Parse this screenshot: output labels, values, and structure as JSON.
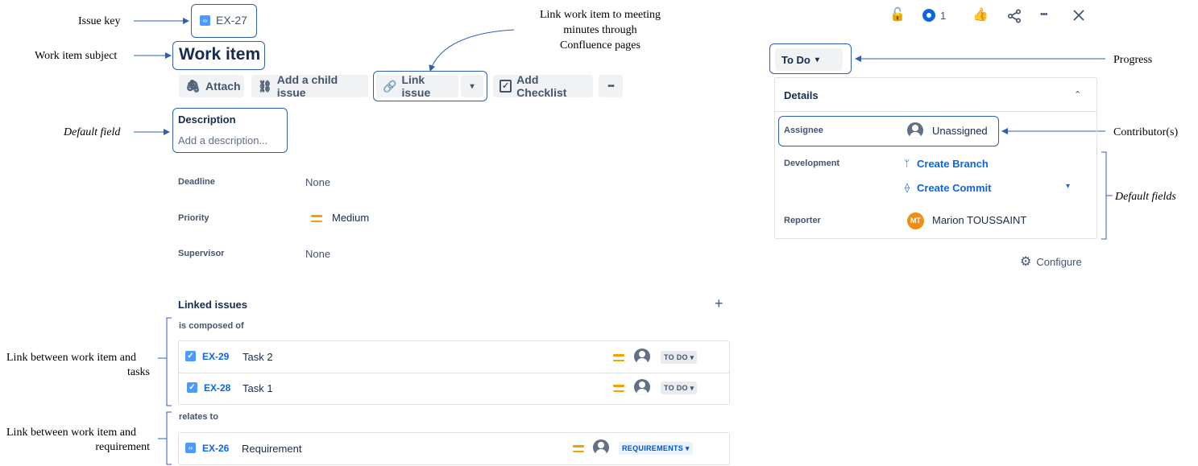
{
  "annotations": {
    "issue_key": "Issue key",
    "work_item_subject": "Work item subject",
    "default_field": "Default field",
    "link_meeting_1": "Link work item to meeting",
    "link_meeting_2": "minutes through",
    "link_meeting_3": "Confluence pages",
    "progress": "Progress",
    "contributors": "Contributor(s)",
    "default_fields": "Default fields",
    "link_tasks_1": "Link between work item and",
    "link_tasks_2": "tasks",
    "link_req_1": "Link between work item and",
    "link_req_2": "requirement"
  },
  "issue": {
    "key": "EX-27",
    "title": "Work item"
  },
  "toolbar": {
    "attach": "Attach",
    "add_child": "Add a child issue",
    "link_issue": "Link issue",
    "add_checklist": "Add Checklist",
    "more": "•••"
  },
  "description": {
    "label": "Description",
    "placeholder": "Add a description..."
  },
  "fields": [
    {
      "label": "Deadline",
      "value": "None"
    },
    {
      "label": "Priority",
      "value": "Medium"
    },
    {
      "label": "Supervisor",
      "value": "None"
    }
  ],
  "linked": {
    "heading": "Linked issues",
    "add": "+",
    "group1": "is composed of",
    "group2": "relates to",
    "items": [
      {
        "key": "EX-29",
        "title": "Task 2",
        "status": "TO DO"
      },
      {
        "key": "EX-28",
        "title": "Task 1",
        "status": "TO DO"
      },
      {
        "key": "EX-26",
        "title": "Requirement",
        "status": "REQUIREMENTS"
      }
    ]
  },
  "topbar": {
    "watchers": "1",
    "more": "•••"
  },
  "status_button": "To Do",
  "details": {
    "heading": "Details",
    "assignee_label": "Assignee",
    "assignee_value": "Unassigned",
    "development_label": "Development",
    "create_branch": "Create Branch",
    "create_commit": "Create Commit",
    "reporter_label": "Reporter",
    "reporter_initials": "MT",
    "reporter_name": "Marion TOUSSAINT",
    "configure": "Configure"
  },
  "colors": {
    "callout": "#2f5fb3",
    "link": "#0c66e4",
    "priority_medium": "#f59f00"
  }
}
